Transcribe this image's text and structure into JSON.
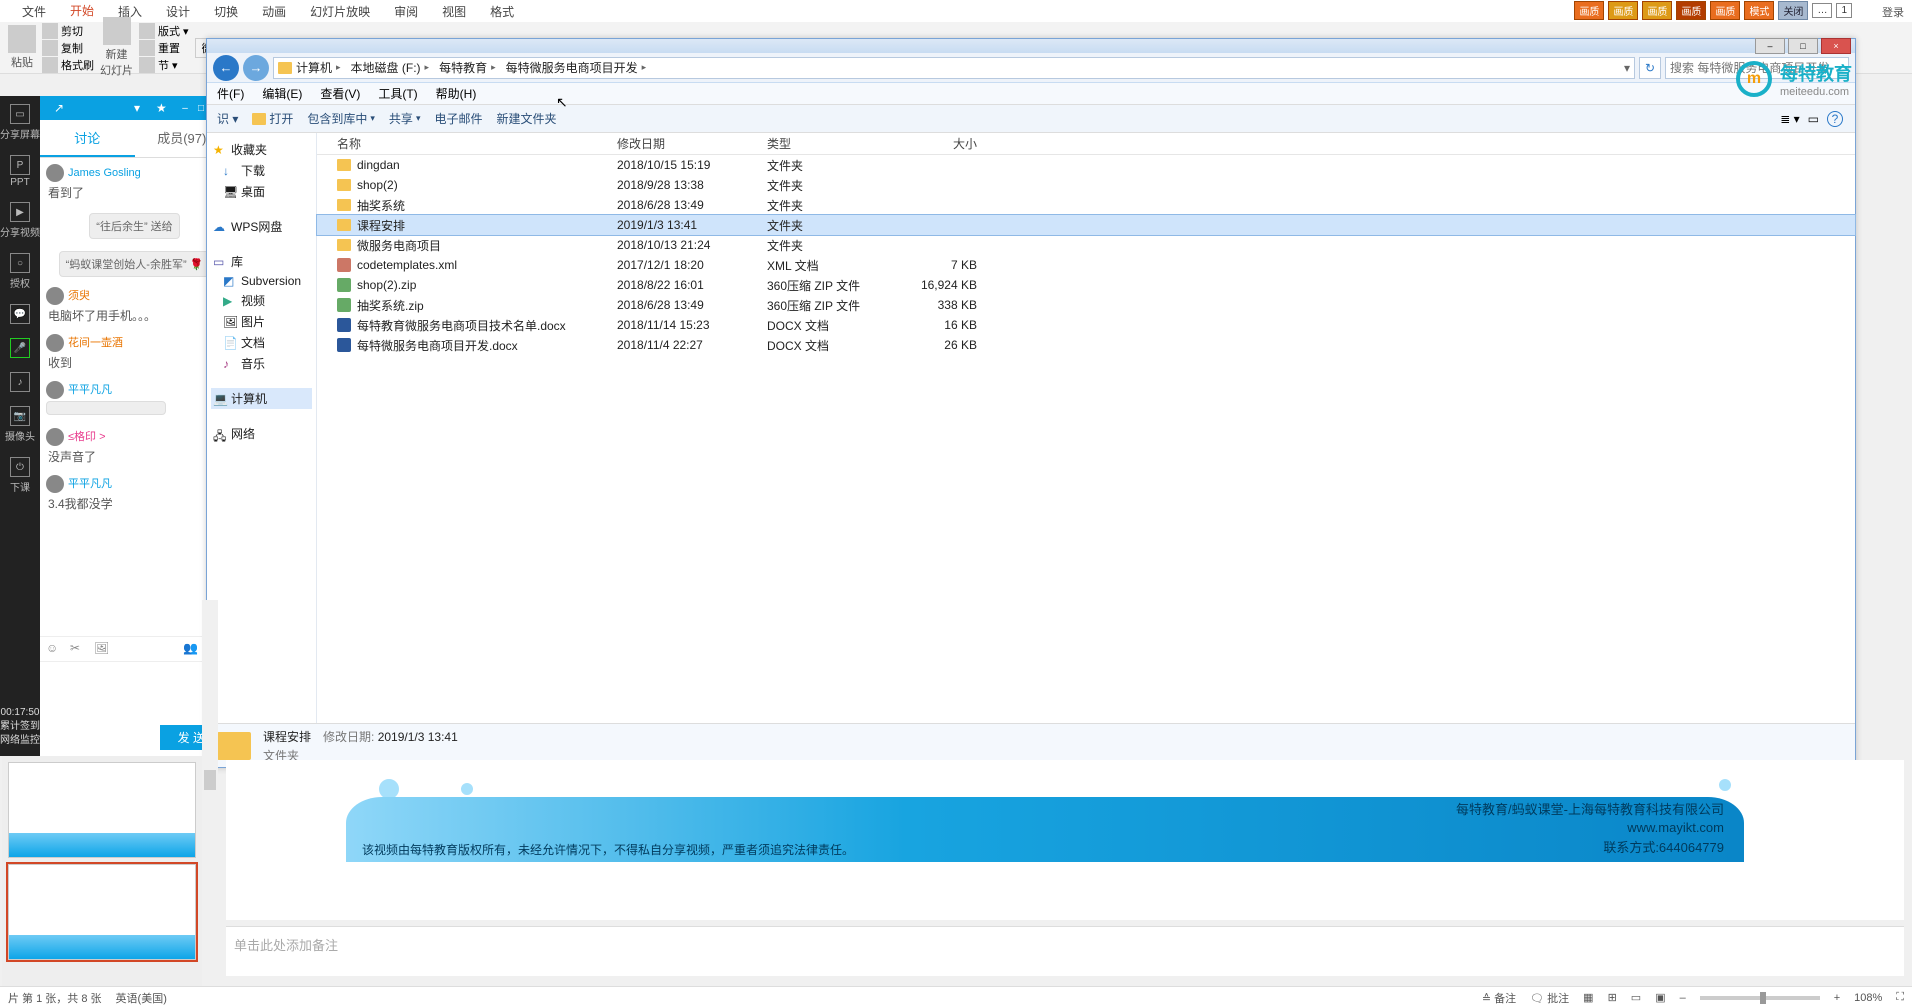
{
  "ppt_tabs": [
    "文件",
    "开始",
    "插入",
    "设计",
    "切换",
    "动画",
    "幻灯片放映",
    "审阅",
    "视图",
    "格式"
  ],
  "ppt_active_tab_index": 1,
  "ppt_tools": {
    "paste": "粘贴",
    "cut": "剪切",
    "copy": "复制",
    "format_painter": "格式刷",
    "new_slide": "新建\n幻灯片",
    "layout": "版式 ▾",
    "reset": "重置",
    "section": "节 ▾"
  },
  "top_badges": [
    "画质",
    "画质",
    "画质",
    "画质",
    "画质",
    "模式",
    "关闭",
    "…",
    "1"
  ],
  "login_label": "登录",
  "classin_sidebar": [
    {
      "icon": "share",
      "label": "分享屏幕"
    },
    {
      "icon": "ppt",
      "label": "PPT"
    },
    {
      "icon": "video",
      "label": "分享视频"
    },
    {
      "icon": "auth",
      "label": "授权"
    },
    {
      "icon": "chat",
      "label": ""
    },
    {
      "icon": "mic",
      "label": ""
    },
    {
      "icon": "music",
      "label": ""
    },
    {
      "icon": "cam",
      "label": "摄像头"
    },
    {
      "icon": "more",
      "label": "下课"
    }
  ],
  "classin_timer": "00:17:50\n累计签到\n网络监控",
  "chat_tabs": {
    "discussion": "讨论",
    "members": "成员(97)"
  },
  "chat_active": 0,
  "chat_messages": [
    {
      "name": "James Gosling",
      "name_color": "",
      "text": "看到了"
    },
    {
      "name": "",
      "bubble": "“往后余生” 送给"
    },
    {
      "name": "",
      "bubble": "“蚂蚁课堂创始人-余胜军” 🌹"
    },
    {
      "name": "须臾",
      "name_color": "orange",
      "text": "电脑坏了用手机。。。"
    },
    {
      "name": "花间一壶酒",
      "name_color": "orange",
      "text": "收到"
    },
    {
      "name": "平平凡凡",
      "name_color": "",
      "text": ""
    },
    {
      "name": "≤格印 >",
      "name_color": "pink",
      "text": "没声音了"
    },
    {
      "name": "平平凡凡",
      "name_color": "",
      "text": "3.4我都没学"
    }
  ],
  "chat_send": "发 送",
  "explorer": {
    "breadcrumbs": [
      "计算机",
      "本地磁盘 (F:)",
      "每特教育",
      "每特微服务电商项目开发"
    ],
    "search_placeholder": "搜索 每特微服务电商项目开发",
    "menus": [
      "件(F)",
      "编辑(E)",
      "查看(V)",
      "工具(T)",
      "帮助(H)"
    ],
    "toolbar": [
      "识 ▾",
      "打开",
      "包含到库中",
      "共享",
      "电子邮件",
      "新建文件夹"
    ],
    "tree_favorites_label": "收藏夹",
    "tree_favorites": [
      {
        "l": "下载",
        "c": "down-ico"
      },
      {
        "l": "桌面",
        "c": "desk-ico"
      }
    ],
    "tree_wps": "WPS网盘",
    "tree_lib_label": "库",
    "tree_lib": [
      {
        "l": "Subversion",
        "c": "svn-ico"
      },
      {
        "l": "视频",
        "c": "vid-ico"
      },
      {
        "l": "图片",
        "c": "pic-ico"
      },
      {
        "l": "文档",
        "c": "doc-ico"
      },
      {
        "l": "音乐",
        "c": "music-ico"
      }
    ],
    "tree_computer": "计算机",
    "tree_network": "网络",
    "columns": {
      "name": "名称",
      "date": "修改日期",
      "type": "类型",
      "size": "大小"
    },
    "files": [
      {
        "name": "dingdan",
        "date": "2018/10/15 15:19",
        "type": "文件夹",
        "size": "",
        "icon": "folder"
      },
      {
        "name": "shop(2)",
        "date": "2018/9/28 13:38",
        "type": "文件夹",
        "size": "",
        "icon": "folder"
      },
      {
        "name": "抽奖系统",
        "date": "2018/6/28 13:49",
        "type": "文件夹",
        "size": "",
        "icon": "folder"
      },
      {
        "name": "课程安排",
        "date": "2019/1/3 13:41",
        "type": "文件夹",
        "size": "",
        "icon": "folder",
        "selected": true
      },
      {
        "name": "微服务电商项目",
        "date": "2018/10/13 21:24",
        "type": "文件夹",
        "size": "",
        "icon": "folder"
      },
      {
        "name": "codetemplates.xml",
        "date": "2017/12/1 18:20",
        "type": "XML 文档",
        "size": "7 KB",
        "icon": "xml"
      },
      {
        "name": "shop(2).zip",
        "date": "2018/8/22 16:01",
        "type": "360压缩 ZIP 文件",
        "size": "16,924 KB",
        "icon": "zip"
      },
      {
        "name": "抽奖系统.zip",
        "date": "2018/6/28 13:49",
        "type": "360压缩 ZIP 文件",
        "size": "338 KB",
        "icon": "zip"
      },
      {
        "name": "每特教育微服务电商项目技术名单.docx",
        "date": "2018/11/14 15:23",
        "type": "DOCX 文档",
        "size": "16 KB",
        "icon": "docx"
      },
      {
        "name": "每特微服务电商项目开发.docx",
        "date": "2018/11/4 22:27",
        "type": "DOCX 文档",
        "size": "26 KB",
        "icon": "docx"
      }
    ],
    "status": {
      "title": "课程安排",
      "date_label": "修改日期:",
      "date": "2019/1/3 13:41",
      "type": "文件夹"
    }
  },
  "logo": {
    "brand": "每特教育",
    "url": "meiteedu.com",
    "mark": "m"
  },
  "slide_footer": {
    "company": "每特教育/蚂蚁课堂-上海每特教育科技有限公司",
    "url": "www.mayikt.com",
    "contact": "联系方式:644064779",
    "copyright": "该视频由每特教育版权所有，未经允许情况下，不得私自分享视频，严重者须追究法律责任。"
  },
  "notes_placeholder": "单击此处添加备注",
  "ppt_status": {
    "left": "片 第 1 张，共 8 张",
    "lang": "英语(美国)",
    "comments": "批注",
    "notes": "备注",
    "zoom": "108%"
  }
}
